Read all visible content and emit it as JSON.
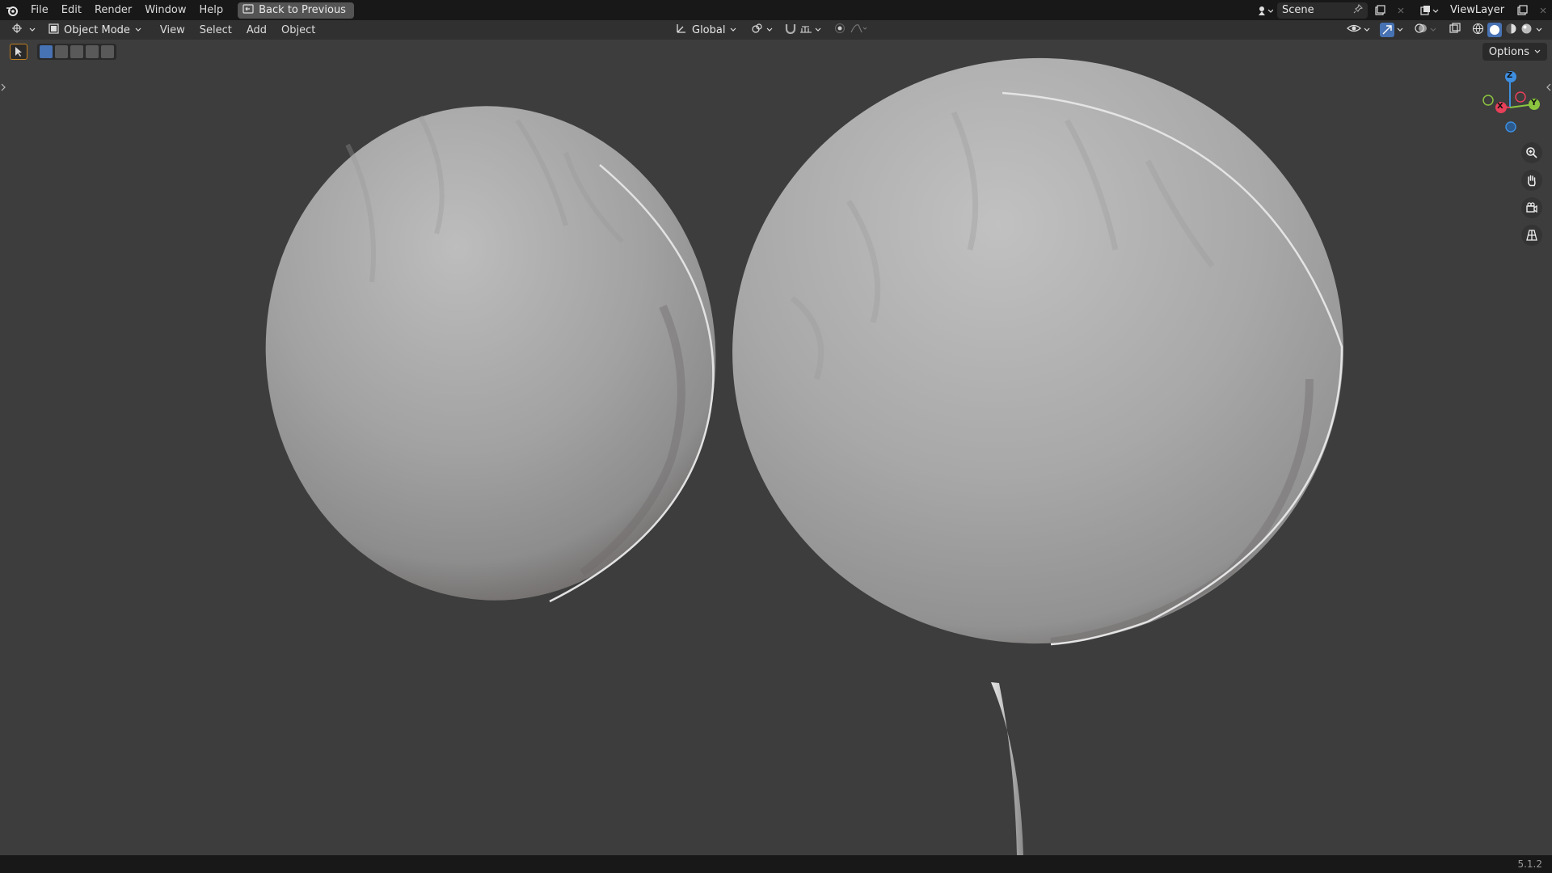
{
  "topbar": {
    "menus": [
      "File",
      "Edit",
      "Render",
      "Window",
      "Help"
    ],
    "back_label": "Back to Previous",
    "scene_name": "Scene",
    "view_layer": "ViewLayer"
  },
  "header": {
    "mode": "Object Mode",
    "menus": [
      "View",
      "Select",
      "Add",
      "Object"
    ],
    "transform_orientation": "Global"
  },
  "viewport": {
    "options_label": "Options",
    "gizmo_axes": [
      "Z",
      "X",
      "Y"
    ]
  },
  "statusbar": {
    "version": "5.1.2"
  },
  "colors": {
    "accent": "#4772b3",
    "axis_x": "#e8405a",
    "axis_y": "#8bc53f",
    "axis_z": "#3d8ee0"
  }
}
